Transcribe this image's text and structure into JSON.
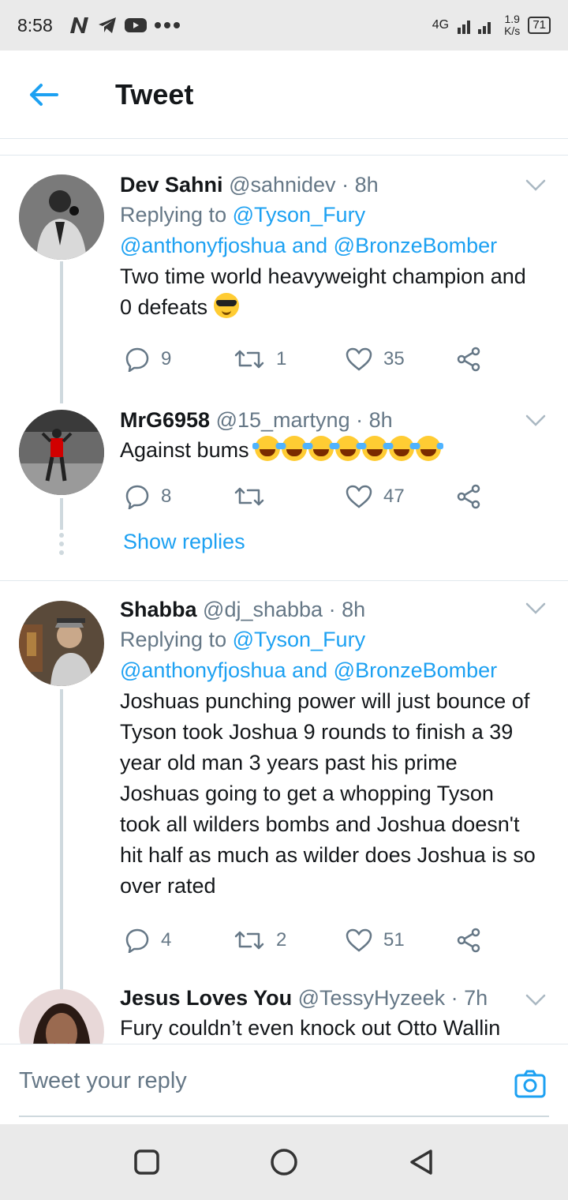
{
  "status": {
    "time": "8:58",
    "network": "4G",
    "speed_value": "1.9",
    "speed_unit": "K/s",
    "battery": "71"
  },
  "header": {
    "title": "Tweet"
  },
  "tweets": [
    {
      "name": "Dev Sahni",
      "handle": "@sahnidev",
      "time": "· 8h",
      "replying_label": "Replying to",
      "reply_mention_1": "@Tyson_Fury",
      "reply_mention_2": "@anthonyfjoshua",
      "reply_and": "and",
      "reply_mention_3": "@BronzeBomber",
      "text": "Two time world heavyweight champion and 0 defeats",
      "replies": "9",
      "retweets": "1",
      "likes": "35"
    },
    {
      "name": "MrG6958",
      "handle": "@15_martyng",
      "time": "· 8h",
      "text": "Against bums",
      "replies": "8",
      "retweets": "",
      "likes": "47"
    },
    {
      "name": "Shabba",
      "handle": "@dj_shabba",
      "time": "· 8h",
      "replying_label": "Replying to",
      "reply_mention_1": "@Tyson_Fury",
      "reply_mention_2": "@anthonyfjoshua",
      "reply_and": "and",
      "reply_mention_3": "@BronzeBomber",
      "text": "Joshuas punching power will just bounce of Tyson took Joshua 9 rounds to finish a 39 year old man 3 years past his prime Joshuas going to get a whopping Tyson took all wilders bombs and Joshua doesn't hit half as much as wilder does Joshua is so over rated",
      "replies": "4",
      "retweets": "2",
      "likes": "51"
    },
    {
      "name": "Jesus Loves You",
      "handle": "@TessyHyzeek",
      "time": "· 7h",
      "text": "Fury couldn’t even knock out Otto Wallin"
    }
  ],
  "show_replies": "Show replies",
  "reply_bar": {
    "placeholder": "Tweet your reply"
  },
  "colors": {
    "accent": "#1da1f2",
    "muted": "#657786",
    "line": "#cfd9de"
  }
}
